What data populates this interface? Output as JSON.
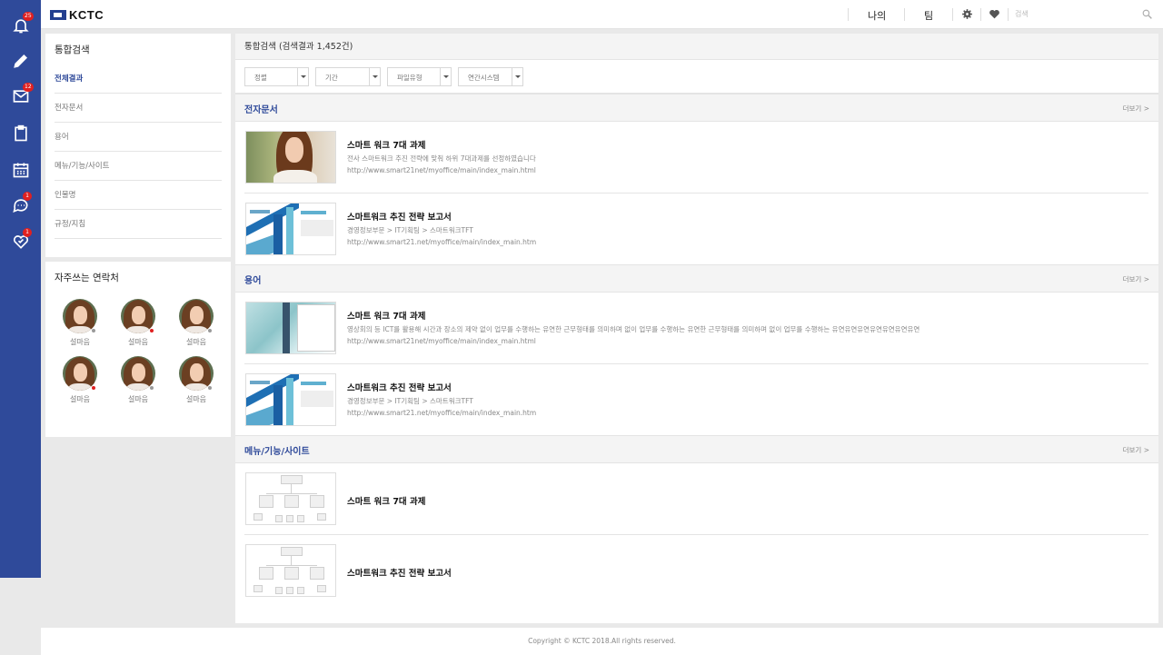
{
  "rail": {
    "items": [
      {
        "icon": "bell-icon",
        "badge": "25"
      },
      {
        "icon": "pencil-icon",
        "badge": ""
      },
      {
        "icon": "mail-icon",
        "badge": "12"
      },
      {
        "icon": "clipboard-icon",
        "badge": ""
      },
      {
        "icon": "calendar-icon",
        "badge": ""
      },
      {
        "icon": "chat-icon",
        "badge": "1"
      },
      {
        "icon": "heart-check-icon",
        "badge": "1"
      }
    ]
  },
  "topbar": {
    "logo": "KCTC",
    "my_label": "나의",
    "team_label": "팀",
    "search_placeholder": "검색"
  },
  "sidebar": {
    "title": "통합검색",
    "items": [
      {
        "label": "전체결과",
        "active": true
      },
      {
        "label": "전자문서",
        "active": false
      },
      {
        "label": "용어",
        "active": false
      },
      {
        "label": "메뉴/기능/사이트",
        "active": false
      },
      {
        "label": "인물명",
        "active": false
      },
      {
        "label": "규정/지침",
        "active": false
      }
    ]
  },
  "contacts": {
    "title": "자주쓰는 연락처",
    "people": [
      {
        "name": "설마음",
        "status": "#9a9a9a"
      },
      {
        "name": "설마음",
        "status": "#e02020"
      },
      {
        "name": "설마음",
        "status": "#9a9a9a"
      },
      {
        "name": "설마음",
        "status": "#e02020"
      },
      {
        "name": "설마음",
        "status": "#9a9a9a"
      },
      {
        "name": "설마음",
        "status": "#9a9a9a"
      }
    ]
  },
  "main": {
    "header": "통합검색 (검색결과 1,452건)",
    "filters": [
      "정렬",
      "기간",
      "파일유형",
      "연간시스템"
    ],
    "more_label": "더보기  >",
    "sections": [
      {
        "title": "전자문서",
        "results": [
          {
            "thumb": "photo",
            "title": "스마트 워크 7대 과제",
            "desc": "전사 스마트워크 추진 전략에 맞춰 하위 7대과제를 선정하였습니다",
            "url": "http://www.smart21net/myoffice/main/index_main.html"
          },
          {
            "thumb": "doc",
            "title": "스마트워크 추진 전략 보고서",
            "desc": "경영정보부문 > IT기획팀 > 스마트워크TFT",
            "url": "http://www.smart21.net/myoffice/main/index_main.htm"
          }
        ]
      },
      {
        "title": "용어",
        "results": [
          {
            "thumb": "term",
            "title": "스마트 워크 7대 과제",
            "desc": "영상회의 등 ICT를 활용해 시간과 장소의 제약 없이 업무를 수행하는 유연한 근무형태를 의미하며 없이 업무를 수행하는 유연한 근무형태를 의미하며 없이 업무를 수행하는 유연유연유연유연유연유연유연",
            "url": "http://www.smart21net/myoffice/main/index_main.html"
          },
          {
            "thumb": "doc",
            "title": "스마트워크 추진 전략 보고서",
            "desc": "경영정보부문 > IT기획팀 > 스마트워크TFT",
            "url": "http://www.smart21.net/myoffice/main/index_main.htm"
          }
        ]
      },
      {
        "title": "메뉴/기능/사이트",
        "results": [
          {
            "thumb": "diagram",
            "title": "스마트 워크 7대 과제",
            "desc": "",
            "url": ""
          },
          {
            "thumb": "diagram",
            "title": "스마트워크 추진 전략 보고서",
            "desc": "",
            "url": ""
          }
        ]
      }
    ]
  },
  "footer": "Copyright © KCTC 2018.All rights reserved."
}
